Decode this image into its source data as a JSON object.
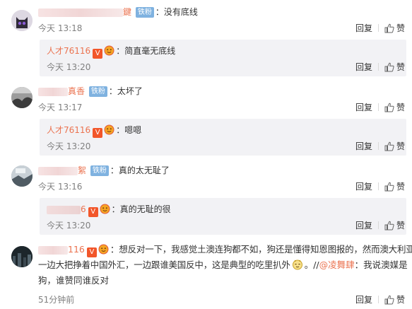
{
  "comments": [
    {
      "name_visible": "鍵",
      "fan_badge": "铁粉",
      "text": "没有底线",
      "time": "今天 13:18",
      "reply_label": "回复",
      "like_count": "赞",
      "reply": {
        "name": "人才76116",
        "v_badge": "V",
        "text": "简直毫无底线",
        "time": "今天 13:20",
        "reply_label": "回复",
        "like_count": "赞"
      }
    },
    {
      "name_visible": "真香",
      "fan_badge": "铁粉",
      "text": "太坏了",
      "time": "今天 13:17",
      "reply_label": "回复",
      "like_count": "赞",
      "reply": {
        "name": "人才76116",
        "v_badge": "V",
        "text": "嗯嗯",
        "time": "今天 13:20",
        "reply_label": "回复",
        "like_count": "赞"
      }
    },
    {
      "name_visible": "絮",
      "fan_badge": "铁粉",
      "text": "真的太无耻了",
      "time": "今天 13:16",
      "reply_label": "回复",
      "like_count": "赞",
      "reply": {
        "name": "6",
        "v_badge": "V",
        "text": "真的无耻的很",
        "time": "今天 13:20",
        "reply_label": "回复",
        "like_count": "赞"
      }
    }
  ],
  "long_comment": {
    "name": "116",
    "v_badge": "V",
    "line1": "想反对一下，我感觉土澳连狗都不如，狗还是懂得知恩图报的，然而澳大利亚",
    "line2_a": "一边大把挣着中国外汇，一边跟谁美国反中，这是典型的吃里扒外",
    "line2_b": "。//",
    "mention": "@凌舞肆",
    "line2_c": "：我说澳媒是",
    "line3": "狗，谁赞同谁反对",
    "time": "51分钟前",
    "reply_label": "回复",
    "like_count": "赞"
  },
  "colors": {
    "name_orange": "#eb7350",
    "fan_badge_blue": "#7fb2e0",
    "v_badge_red": "#f2562a",
    "reply_bg": "#f2f2f5",
    "time_gray": "#808080"
  }
}
